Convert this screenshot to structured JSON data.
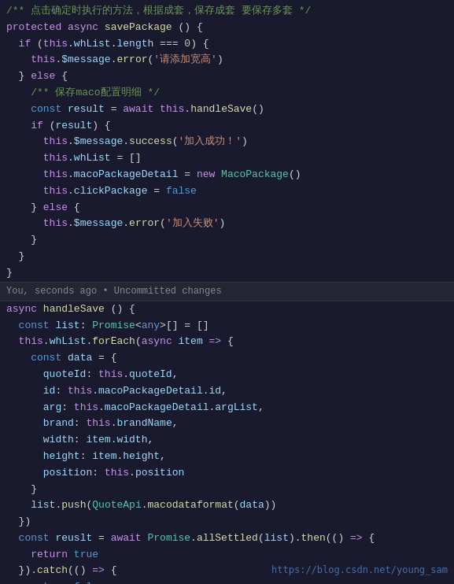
{
  "code": {
    "lines": [
      {
        "id": 1,
        "type": "comment",
        "text": "/** 点击确定时执行的方法，根据成套，保存成套 要保存多套 */"
      },
      {
        "id": 2,
        "type": "code",
        "text": "protected async savePackage () {"
      },
      {
        "id": 3,
        "type": "code",
        "text": "  if (this.whList.length === 0) {"
      },
      {
        "id": 4,
        "type": "code",
        "text": "    this.$message.error('请添加宽高')"
      },
      {
        "id": 5,
        "type": "code",
        "text": "  } else {"
      },
      {
        "id": 6,
        "type": "code",
        "text": "    /** 保存maco配置明细 */"
      },
      {
        "id": 7,
        "type": "code",
        "text": "    const result = await this.handleSave()"
      },
      {
        "id": 8,
        "type": "code",
        "text": "    if (result) {"
      },
      {
        "id": 9,
        "type": "code",
        "text": "      this.$message.success('加入成功！')"
      },
      {
        "id": 10,
        "type": "code",
        "text": "      this.whList = []"
      },
      {
        "id": 11,
        "type": "code",
        "text": "      this.macoPackageDetail = new MacoPackage()"
      },
      {
        "id": 12,
        "type": "code",
        "text": "      this.clickPackage = false"
      },
      {
        "id": 13,
        "type": "code",
        "text": "    } else {"
      },
      {
        "id": 14,
        "type": "code",
        "text": "      this.$message.error('加入失败')"
      },
      {
        "id": 15,
        "type": "code",
        "text": "    }"
      },
      {
        "id": 16,
        "type": "code",
        "text": "  }"
      },
      {
        "id": 17,
        "type": "code",
        "text": "}"
      }
    ],
    "git_status": "You, seconds ago • Uncommitted changes",
    "watermark": "https://blog.csdn.net/young_sam"
  }
}
